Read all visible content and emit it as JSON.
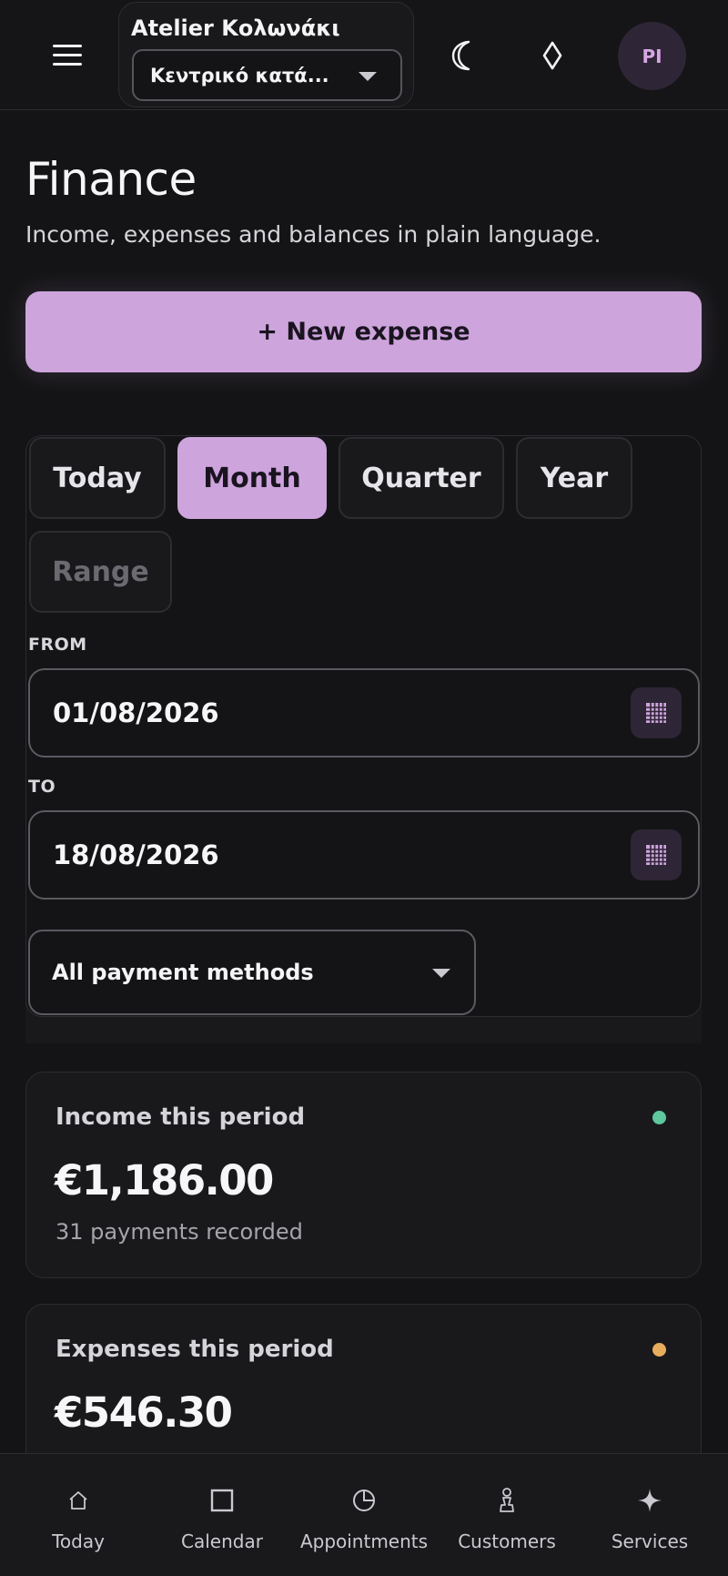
{
  "header": {
    "workspace_name": "Atelier Κολωνάκι",
    "location_select": "Κεντρικό κατά...",
    "avatar_initials": "PI",
    "theme_icon": "moon-icon",
    "diamond_icon": "diamond-icon"
  },
  "page": {
    "title": "Finance",
    "subtitle": "Income, expenses and balances in plain language.",
    "new_expense_label": "+ New expense"
  },
  "filters": {
    "periods": [
      "Today",
      "Month",
      "Quarter",
      "Year",
      "Range"
    ],
    "active_period": "Month",
    "from_label": "FROM",
    "from_value": "01/08/2026",
    "to_label": "TO",
    "to_value": "18/08/2026",
    "payment_method": "All payment methods"
  },
  "stats": {
    "income": {
      "label": "Income this period",
      "value": "€1,186.00",
      "note": "31 payments recorded",
      "dot_color": "#5ec79e"
    },
    "expenses": {
      "label": "Expenses this period",
      "value": "€546.30",
      "dot_color": "#e8ad5c"
    }
  },
  "nav": {
    "items": [
      {
        "label": "Today",
        "icon": "home-icon"
      },
      {
        "label": "Calendar",
        "icon": "calendar-icon"
      },
      {
        "label": "Appointments",
        "icon": "clock-icon"
      },
      {
        "label": "Customers",
        "icon": "person-icon"
      },
      {
        "label": "Services",
        "icon": "sparkle-icon"
      }
    ]
  },
  "colors": {
    "accent": "#cda4dc",
    "background": "#141416",
    "card": "#19191c"
  }
}
